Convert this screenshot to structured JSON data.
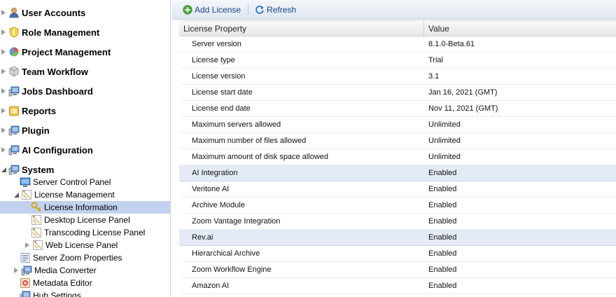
{
  "sidebar": {
    "items": [
      {
        "label": "User Accounts",
        "icon": "user-icon"
      },
      {
        "label": "Role Management",
        "icon": "shield-icon"
      },
      {
        "label": "Project Management",
        "icon": "pie-chart-icon"
      },
      {
        "label": "Team Workflow",
        "icon": "cubes-icon"
      },
      {
        "label": "Jobs Dashboard",
        "icon": "computer-icon"
      },
      {
        "label": "Reports",
        "icon": "reports-icon"
      },
      {
        "label": "Plugin",
        "icon": "computer-icon"
      },
      {
        "label": "AI Configuration",
        "icon": "computer-icon"
      },
      {
        "label": "System",
        "icon": "computer-icon"
      }
    ],
    "system_children": [
      {
        "label": "Server Control Panel",
        "icon": "monitor-icon"
      },
      {
        "label": "License Management",
        "icon": "license-icon"
      },
      {
        "label": "License Information",
        "icon": "key-icon"
      },
      {
        "label": "Desktop License Panel",
        "icon": "license-icon"
      },
      {
        "label": "Transcoding License Panel",
        "icon": "license-icon"
      },
      {
        "label": "Web License Panel",
        "icon": "license-icon"
      },
      {
        "label": "Server Zoom Properties",
        "icon": "properties-icon"
      },
      {
        "label": "Media Converter",
        "icon": "computer-icon"
      },
      {
        "label": "Metadata Editor",
        "icon": "metadata-icon"
      },
      {
        "label": "Hub Settings",
        "icon": "computer-icon"
      }
    ]
  },
  "toolbar": {
    "add_label": "Add License",
    "refresh_label": "Refresh"
  },
  "grid": {
    "columns": [
      "License Property",
      "Value"
    ],
    "rows": [
      {
        "property": "Server version",
        "value": "8.1.0-Beta.61"
      },
      {
        "property": "License type",
        "value": "Trial"
      },
      {
        "property": "License version",
        "value": "3.1"
      },
      {
        "property": "License start date",
        "value": "Jan 16, 2021 (GMT)"
      },
      {
        "property": "License end date",
        "value": "Nov 11, 2021 (GMT)"
      },
      {
        "property": "Maximum servers allowed",
        "value": "Unlimited"
      },
      {
        "property": "Maximum number of files allowed",
        "value": "Unlimited"
      },
      {
        "property": "Maximum amount of disk space allowed",
        "value": "Unlimited"
      },
      {
        "property": "AI Integration",
        "value": "Enabled"
      },
      {
        "property": "Veritone AI",
        "value": "Enabled"
      },
      {
        "property": "Archive Module",
        "value": "Enabled"
      },
      {
        "property": "Zoom Vantage Integration",
        "value": "Enabled"
      },
      {
        "property": "Rev.ai",
        "value": "Enabled"
      },
      {
        "property": "Hierarchical Archive",
        "value": "Enabled"
      },
      {
        "property": "Zoom Workflow Engine",
        "value": "Enabled"
      },
      {
        "property": "Amazon AI",
        "value": "Enabled"
      }
    ]
  },
  "colors": {
    "selection": "#c1d2ee",
    "highlight_row": "#e4ebf6",
    "toolbar_text": "#15428b"
  }
}
